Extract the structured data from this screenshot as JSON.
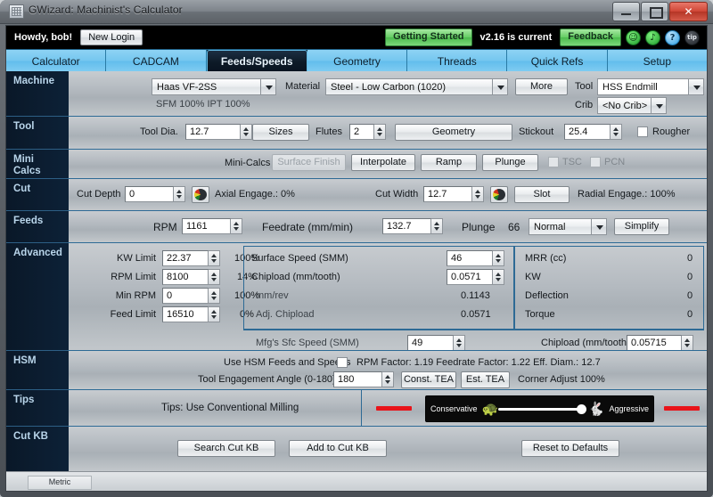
{
  "window": {
    "title": "GWizard: Machinist's Calculator",
    "icon": "app-grid-icon",
    "buttons": {
      "minimize": "minimize",
      "maximize": "maximize",
      "close": "✕"
    }
  },
  "topbar": {
    "greeting": "Howdy, bob!",
    "new_login": "New Login",
    "getting_started": "Getting Started",
    "version": "v2.16 is current",
    "feedback": "Feedback",
    "icons": [
      {
        "name": "smiley-icon",
        "glyph": "☺"
      },
      {
        "name": "headphones-icon",
        "glyph": "♪"
      },
      {
        "name": "help-icon",
        "glyph": "?"
      },
      {
        "name": "tip-icon",
        "glyph": "tip"
      }
    ]
  },
  "tabs": [
    {
      "label": "Calculator",
      "active": false
    },
    {
      "label": "CADCAM",
      "active": false
    },
    {
      "label": "Feeds/Speeds",
      "active": true
    },
    {
      "label": "Geometry",
      "active": false
    },
    {
      "label": "Threads",
      "active": false
    },
    {
      "label": "Quick Refs",
      "active": false
    },
    {
      "label": "Setup",
      "active": false
    }
  ],
  "sections": {
    "machine": "Machine",
    "tool": "Tool",
    "minicalcs_l1": "Mini",
    "minicalcs_l2": "Calcs",
    "cut": "Cut",
    "feeds": "Feeds",
    "advanced": "Advanced",
    "hsm": "HSM",
    "tips": "Tips",
    "cutkb": "Cut KB"
  },
  "machine": {
    "machine_value": "Haas VF-2SS",
    "material_label": "Material",
    "material_value": "Steel - Low Carbon (1020)",
    "more_button": "More",
    "tool_label": "Tool",
    "tool_value": "HSS Endmill",
    "crib_label": "Crib",
    "crib_value": "<No Crib>",
    "percentages": "SFM 100%  IPT 100%"
  },
  "tool": {
    "dia_label": "Tool Dia.",
    "dia_value": "12.7",
    "sizes_button": "Sizes",
    "flutes_label": "Flutes",
    "flutes_value": "2",
    "geometry_button": "Geometry",
    "stickout_label": "Stickout",
    "stickout_value": "25.4",
    "rougher_label": "Rougher",
    "rougher_checked": false
  },
  "minicalcs": {
    "label": "Mini-Calcs",
    "surface_finish": "Surface Finish",
    "interpolate": "Interpolate",
    "ramp": "Ramp",
    "plunge": "Plunge",
    "tsc_label": "TSC",
    "pcn_label": "PCN"
  },
  "cut": {
    "depth_label": "Cut Depth",
    "depth_value": "0",
    "axial_engage": "Axial Engage.: 0%",
    "width_label": "Cut Width",
    "width_value": "12.7",
    "slot_button": "Slot",
    "radial_engage": "Radial Engage.: 100%"
  },
  "feeds": {
    "rpm_label": "RPM",
    "rpm_value": "1161",
    "feedrate_label": "Feedrate (mm/min)",
    "feedrate_value": "132.7",
    "plunge_label": "Plunge",
    "plunge_value": "66",
    "mode_value": "Normal",
    "simplify_button": "Simplify"
  },
  "advanced": {
    "limits": [
      {
        "label": "KW Limit",
        "value": "22.37",
        "pct": "100%"
      },
      {
        "label": "RPM Limit",
        "value": "8100",
        "pct": "14%"
      },
      {
        "label": "Min RPM",
        "value": "0",
        "pct": "100%"
      },
      {
        "label": "Feed Limit",
        "value": "16510",
        "pct": "0%"
      }
    ],
    "surface_speed_label": "Surface Speed (SMM)",
    "surface_speed_value": "46",
    "chipload_label": "Chipload (mm/tooth)",
    "chipload_value": "0.0571",
    "mmrev_label": "mm/rev",
    "mmrev_value": "0.1143",
    "adj_chipload_label": "Adj. Chipload",
    "adj_chipload_value": "0.0571",
    "readouts": [
      {
        "label": "MRR (cc)",
        "value": "0"
      },
      {
        "label": "KW",
        "value": "0"
      },
      {
        "label": "Deflection",
        "value": "0"
      },
      {
        "label": "Torque",
        "value": "0"
      }
    ],
    "mfgs_label": "Mfg's   Sfc Speed (SMM)",
    "mfgs_value": "49",
    "mfgs_chipload_label": "Chipload (mm/tooth)",
    "mfgs_chipload_value": "0.05715"
  },
  "hsm": {
    "use_hsm_label": "Use HSM Feeds and Speeds",
    "use_hsm_checked": false,
    "factors": "RPM Factor: 1.19  Feedrate Factor: 1.22  Eff. Diam.: 12.7",
    "tea_label": "Tool Engagement Angle (0-180)",
    "tea_value": "180",
    "const_tea": "Const. TEA",
    "est_tea": "Est. TEA",
    "corner_adjust": "Corner Adjust 100%"
  },
  "tips": {
    "text": "Tips:  Use Conventional Milling",
    "conservative": "Conservative",
    "aggressive": "Aggressive",
    "turtle_icon": "turtle-icon",
    "rabbit_icon": "rabbit-icon",
    "slider_position_pct": 100
  },
  "cutkb": {
    "search": "Search Cut KB",
    "add": "Add to Cut KB",
    "reset": "Reset to Defaults"
  },
  "status": {
    "units": "Metric"
  },
  "colors": {
    "accent_blue": "#74c6ef",
    "green": "#64cc63",
    "red": "#e8141a",
    "dark_navy": "#0d2137"
  }
}
